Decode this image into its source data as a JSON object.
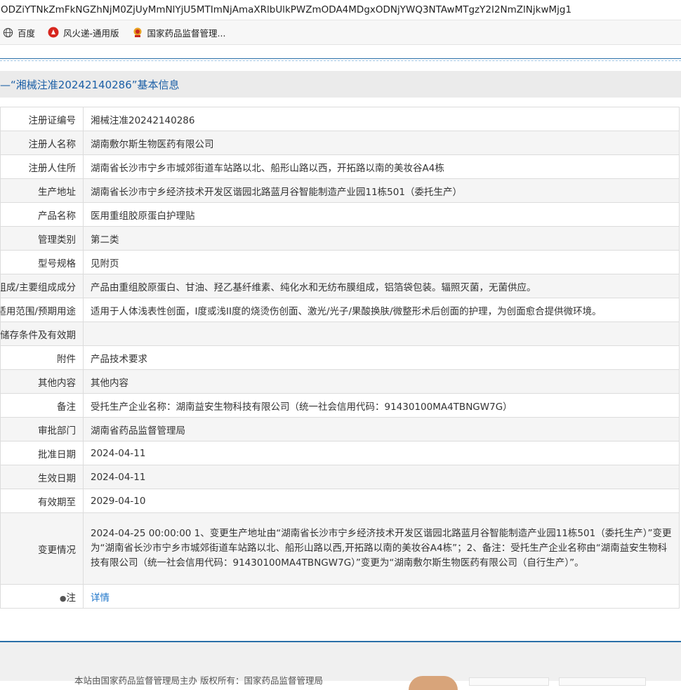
{
  "browser": {
    "url": "ODZiYTNkZmFkNGZhNjM0ZjUyMmNlYjU5MTImNjAmaXRlbUlkPWZmODA4MDgxODNjYWQ3NTAwMTgzY2I2NmZlNjkwMjg1",
    "bookmarks": [
      {
        "label": "百度",
        "icon": "globe-icon"
      },
      {
        "label": "风火递-通用版",
        "icon": "red-logo-icon"
      },
      {
        "label": "国家药品监督管理...",
        "icon": "emblem-icon"
      }
    ]
  },
  "page": {
    "title": "—“湘械注准20242140286”基本信息",
    "rows": [
      {
        "label": "注册证编号",
        "value": "湘械注准20242140286"
      },
      {
        "label": "注册人名称",
        "value": "湖南敷尔斯生物医药有限公司"
      },
      {
        "label": "注册人住所",
        "value": "湖南省长沙市宁乡市城郊街道车站路以北、船形山路以西，开拓路以南的美妆谷A4栋"
      },
      {
        "label": "生产地址",
        "value": "湖南省长沙市宁乡经济技术开发区谐园北路蓝月谷智能制造产业园11栋501（委托生产）"
      },
      {
        "label": "产品名称",
        "value": "医用重组胶原蛋白护理贴"
      },
      {
        "label": "管理类别",
        "value": "第二类"
      },
      {
        "label": "型号规格",
        "value": "见附页"
      },
      {
        "label": "结构及组成/主要组成成分",
        "value": "产品由重组胶原蛋白、甘油、羟乙基纤维素、纯化水和无纺布膜组成，铝箔袋包装。辐照灭菌，无菌供应。"
      },
      {
        "label": "适用范围/预期用途",
        "value": "适用于人体浅表性创面，I度或浅II度的烧烫伤创面、激光/光子/果酸换肤/微整形术后创面的护理，为创面愈合提供微环境。"
      },
      {
        "label": "产品储存条件及有效期",
        "value": ""
      },
      {
        "label": "附件",
        "value": "产品技术要求"
      },
      {
        "label": "其他内容",
        "value": "其他内容"
      },
      {
        "label": "备注",
        "value": "受托生产企业名称：湖南益安生物科技有限公司（统一社会信用代码：91430100MA4TBNGW7G）"
      },
      {
        "label": "审批部门",
        "value": "湖南省药品监督管理局"
      },
      {
        "label": "批准日期",
        "value": "2024-04-11"
      },
      {
        "label": "生效日期",
        "value": "2024-04-11"
      },
      {
        "label": "有效期至",
        "value": "2029-04-10"
      },
      {
        "label": "变更情况",
        "value": "2024-04-25 00:00:00 1、变更生产地址由“湖南省长沙市宁乡经济技术开发区谐园北路蓝月谷智能制造产业园11栋501（委托生产）”变更为“湖南省长沙市宁乡市城郊街道车站路以北、船形山路以西,开拓路以南的美妆谷A4栋”；2、备注：受托生产企业名称由“湖南益安生物科技有限公司（统一社会信用代码：91430100MA4TBNGW7G）”变更为“湖南敷尔斯生物医药有限公司（自行生产）”。"
      },
      {
        "label": "注",
        "value": "详情"
      }
    ]
  },
  "footer": {
    "text": "本站由国家药品监督管理局主办 版权所有：国家药品监督管理局"
  },
  "colors": {
    "title": "#1b5fa6",
    "link": "#1a73c9",
    "rule": "#2a6fa8"
  }
}
